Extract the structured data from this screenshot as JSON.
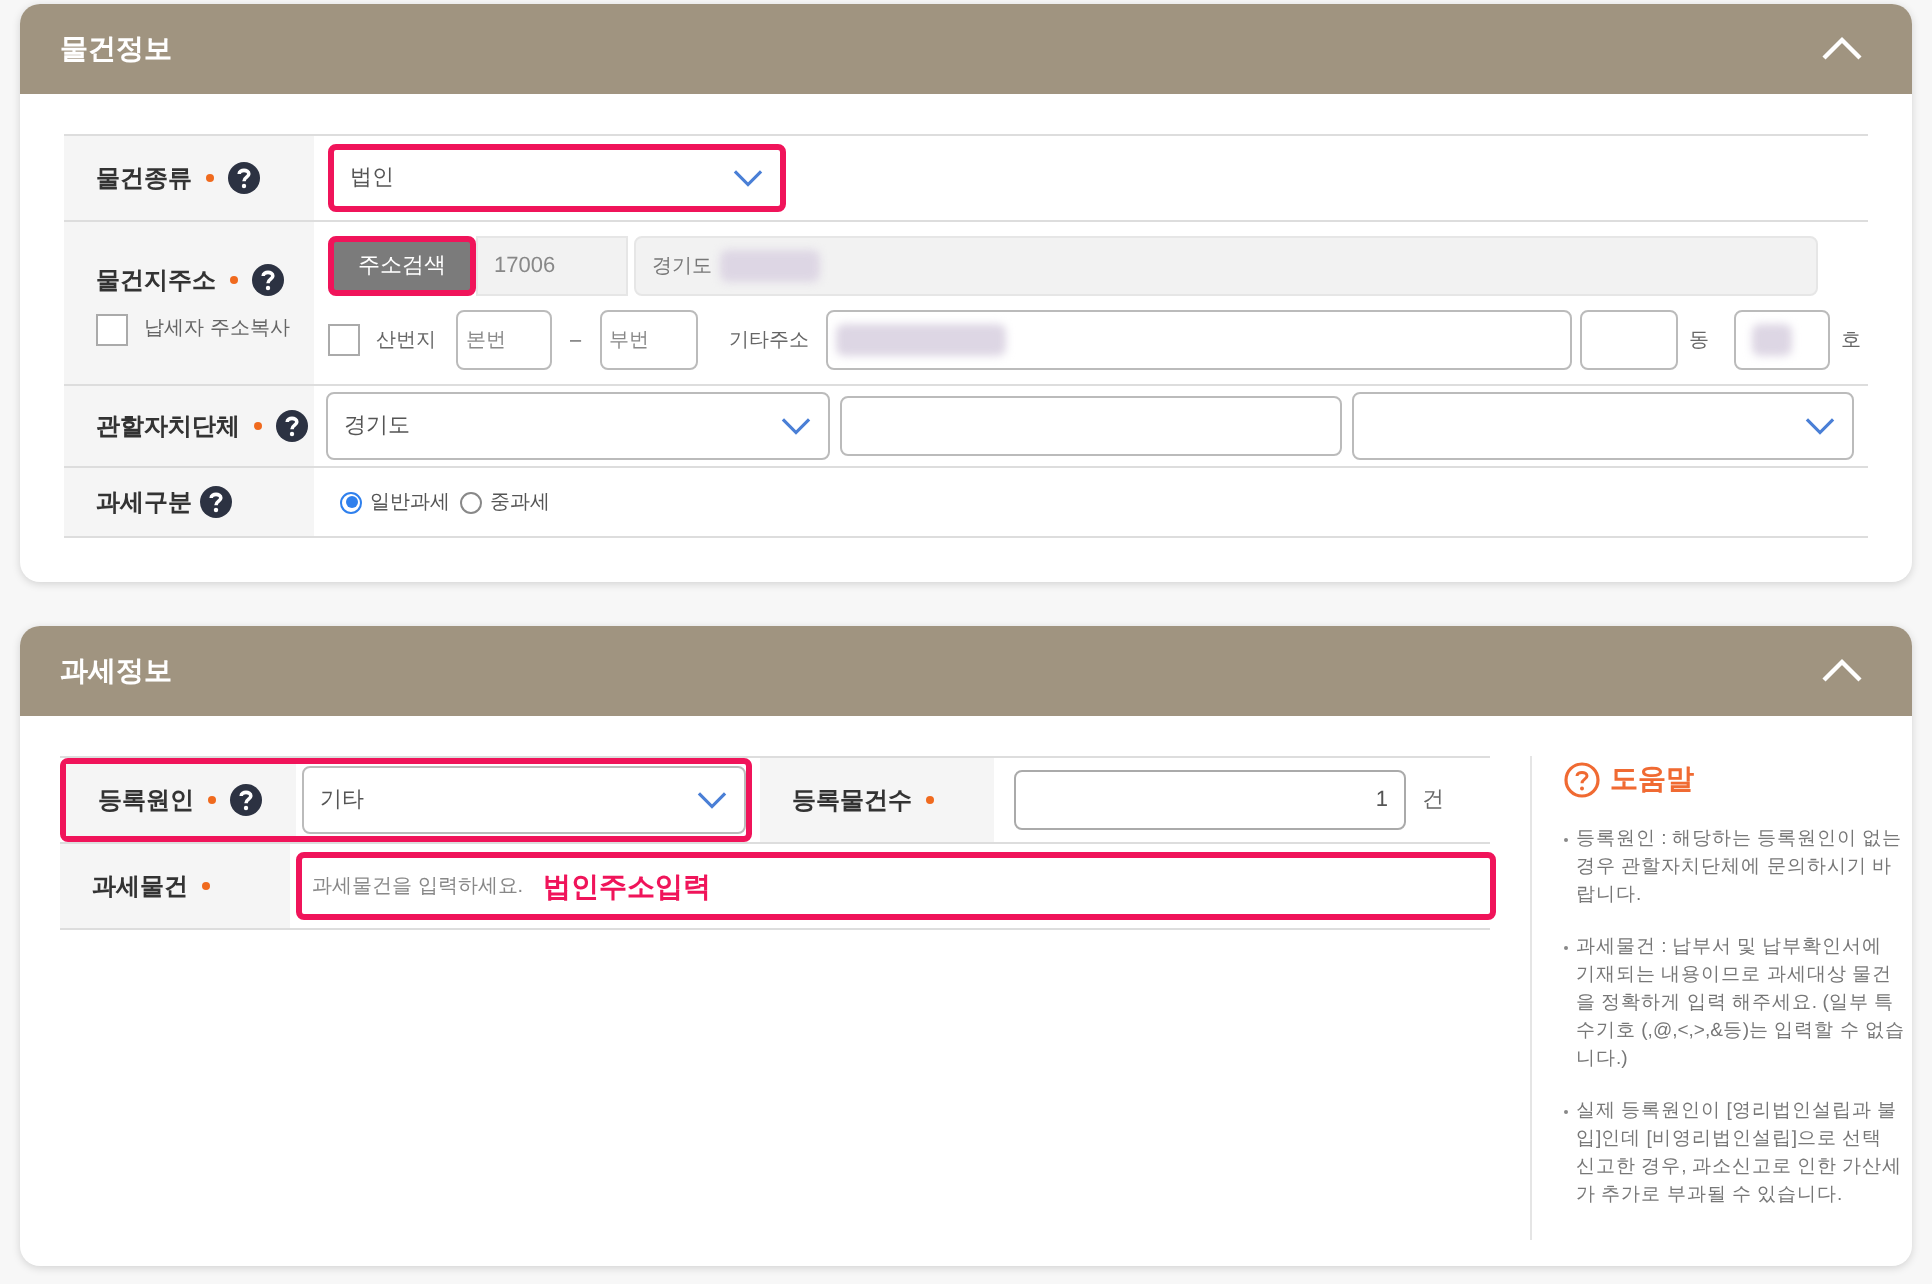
{
  "property_info": {
    "title": "물건정보",
    "expanded": true,
    "property_type": {
      "label": "물건종류",
      "required": true,
      "help": true,
      "value": "법인",
      "highlighted": true
    },
    "address": {
      "label": "물건지주소",
      "required": true,
      "help": true,
      "copy_checkbox": {
        "label": "납세자 주소복사",
        "checked": false
      },
      "search_button": {
        "label": "주소검색",
        "highlighted": true
      },
      "postal_code": "17006",
      "address": "경기도",
      "address_redacted": true,
      "mountain_checkbox": {
        "label": "산번지",
        "checked": false
      },
      "main_number": {
        "placeholder": "본번"
      },
      "separator": "–",
      "sub_number": {
        "placeholder": "부번"
      },
      "other_label": "기타주소",
      "other_redacted": true,
      "dong_unit": "동",
      "ho_unit": "호",
      "ho_redacted": true
    },
    "jurisdiction": {
      "label": "관할자치단체",
      "required": true,
      "help": true,
      "fields": [
        {
          "kind": "select",
          "value": "경기도"
        },
        {
          "kind": "input"
        },
        {
          "kind": "select"
        }
      ]
    },
    "tax_type": {
      "label": "과세구분",
      "required": false,
      "help": true,
      "options": [
        {
          "label": "일반과세",
          "selected": true
        },
        {
          "label": "중과세",
          "selected": false
        }
      ]
    }
  },
  "tax_info": {
    "title": "과세정보",
    "expanded": true,
    "registration_cause": {
      "label": "등록원인",
      "required": true,
      "help": true,
      "value": "기타",
      "highlighted": true
    },
    "item_count": {
      "label": "등록물건수",
      "required": true,
      "value": "1",
      "unit": "건"
    },
    "tax_object": {
      "label": "과세물건",
      "required": true,
      "placeholder": "과세물건을 입력하세요.",
      "highlighted": true,
      "annotation": "법인주소입력"
    },
    "help": {
      "title": "도움말",
      "items": [
        "등록원인 : 해당하는 등록원인이 없는 경우 관할자치단체에 문의하시기 바랍니다.",
        "과세물건 : 납부서 및 납부확인서에 기재되는 내용이므로 과세대상 물건을 정확하게 입력 해주세요. (일부 특수기호 (,@,<,>,&등)는 입력할 수 없습니다.)",
        "실제 등록원인이 [영리법인설립과 불입]인데 [비영리법인설립]으로 선택 신고한 경우, 과소신고로 인한 가산세가 추가로 부과될 수 있습니다."
      ]
    }
  }
}
